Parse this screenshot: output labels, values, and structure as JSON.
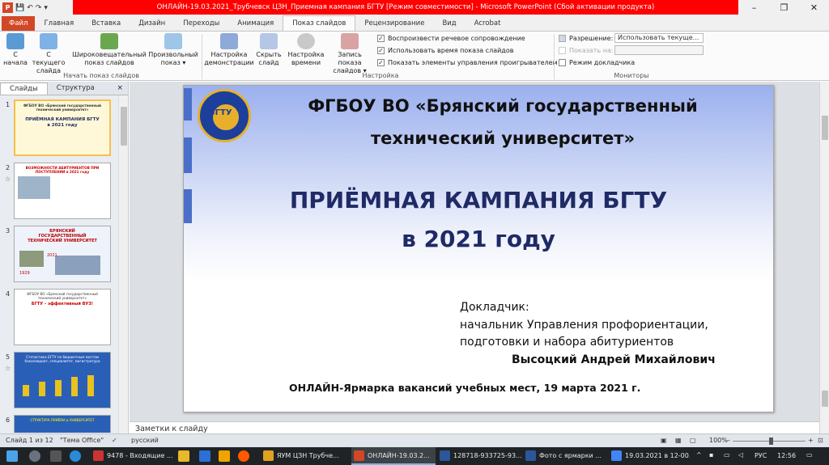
{
  "window": {
    "title": "ОНЛАЙН-19.03.2021_Трубчевск ЦЗН_Приемная кампания БГТУ [Режим совместимости] - Microsoft PowerPoint (Сбой активации продукта)",
    "min": "–",
    "max": "❐",
    "close": "✕"
  },
  "qat": {
    "app": "P",
    "save": "💾",
    "undo": "↶",
    "redo": "↷",
    "more": "▾"
  },
  "tabs": [
    "Файл",
    "Главная",
    "Вставка",
    "Дизайн",
    "Переходы",
    "Анимация",
    "Показ слайдов",
    "Рецензирование",
    "Вид",
    "Acrobat"
  ],
  "active_tab": "Показ слайдов",
  "ribbon": {
    "start_group": "Начать показ слайдов",
    "setup_group": "Настройка",
    "monitors_group": "Мониторы",
    "btn_from_start": [
      "С",
      "начала"
    ],
    "btn_from_current": [
      "С текущего",
      "слайда"
    ],
    "btn_broadcast": [
      "Широковещательный",
      "показ слайдов"
    ],
    "btn_custom": [
      "Произвольный",
      "показ ▾"
    ],
    "btn_setup": [
      "Настройка",
      "демонстрации"
    ],
    "btn_hide": [
      "Скрыть",
      "слайд"
    ],
    "btn_timing": [
      "Настройка",
      "времени"
    ],
    "btn_record": [
      "Запись показа",
      "слайдов ▾"
    ],
    "chk_narration": "Воспроизвести речевое сопровождение",
    "chk_timings": "Использовать время показа слайдов",
    "chk_controls": "Показать элементы управления проигрывателем",
    "resolution_label": "Разрешение:",
    "resolution_value": "Использовать текуще...",
    "show_on_label": "Показать на:",
    "presenter_view": "Режим докладчика"
  },
  "panel": {
    "tab_slides": "Слайды",
    "tab_outline": "Структура",
    "close": "×"
  },
  "thumbs": [
    {
      "num": "1",
      "lines": [
        "ФГБОУ ВО «Брянский государственный",
        "технический университет»",
        "ПРИЁМНАЯ КАМПАНИЯ БГТУ",
        "в 2021 году"
      ]
    },
    {
      "num": "2",
      "lines": [
        "ВОЗМОЖНОСТИ АБИТУРИЕНТОВ ПРИ",
        "ПОСТУПЛЕНИИ в 2021 году"
      ]
    },
    {
      "num": "3",
      "lines": [
        "БРЯНСКИЙ",
        "ГОСУДАРСТВЕННЫЙ",
        "ТЕХНИЧЕСКИЙ УНИВЕРСИТЕТ",
        "2021",
        "1929"
      ]
    },
    {
      "num": "4",
      "lines": [
        "ФГБОУ ВО «Брянский государственный",
        "технический университет»",
        "БГТУ – эффективный ВУЗ!"
      ]
    },
    {
      "num": "5",
      "lines": [
        "Статистика БГТУ по бюджетным местам",
        "бакалавриат, специалитет, магистратура"
      ]
    },
    {
      "num": "6",
      "lines": [
        "СТРУКТУРА ПРИЁМА в УНИВЕРСИТЕТ"
      ]
    }
  ],
  "slide": {
    "logo": "БГТУ",
    "org_line1": "ФГБОУ ВО «Брянский государственный",
    "org_line2": "технический университет»",
    "title_line1": "ПРИЁМНАЯ КАМПАНИЯ БГТУ",
    "title_line2": "в 2021 году",
    "reporter_label": "Докладчик:",
    "reporter_pos1": "начальник Управления профориентации,",
    "reporter_pos2": "подготовки и набора абитуриентов",
    "reporter_name": "Высоцкий Андрей Михайлович",
    "footer": "ОНЛАЙН-Ярмарка вакансий учебных мест, 19 марта 2021 г."
  },
  "notes_placeholder": "Заметки к слайду",
  "status": {
    "slide": "Слайд 1 из 12",
    "theme": "\"Тема Office\"",
    "lang": "русский",
    "zoom": "100%"
  },
  "taskbar": {
    "items": [
      {
        "label": "9478 - Входящие ...",
        "color": "#cc3333"
      },
      {
        "label": "ЯУМ ЦЗН Трубче...",
        "color": "#e0a020"
      },
      {
        "label": "ОНЛАЙН-19.03.2...",
        "color": "#d24726"
      },
      {
        "label": "128718-933725-93...",
        "color": "#2b579a"
      },
      {
        "label": "Фото с ярмарки ...",
        "color": "#2b579a"
      },
      {
        "label": "19.03.2021 в 12-00...",
        "color": "#4285f4"
      }
    ],
    "lang": "РУС",
    "time": "12:56"
  }
}
